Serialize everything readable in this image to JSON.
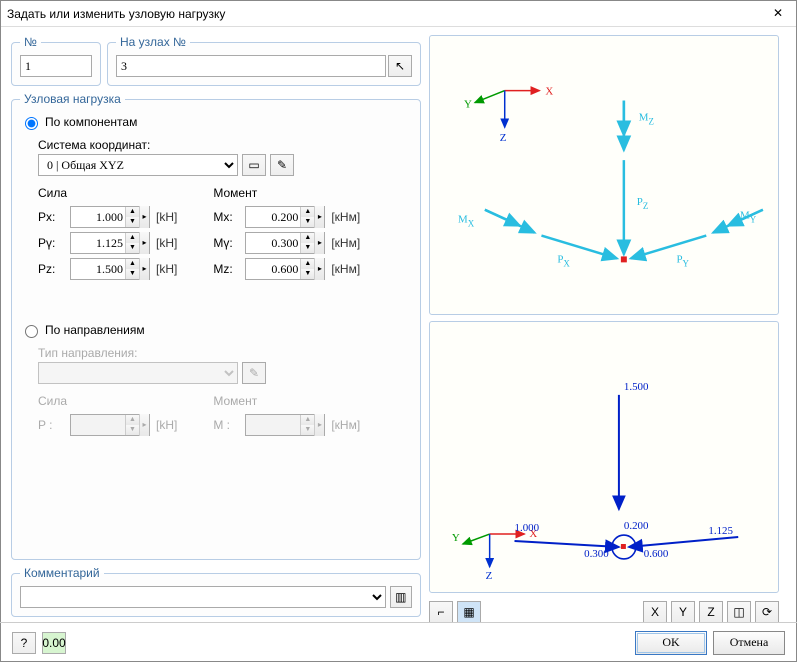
{
  "title": "Задать или изменить узловую нагрузку",
  "top": {
    "num_legend": "№",
    "num_value": "1",
    "nodes_legend": "На узлах №",
    "nodes_value": "3"
  },
  "load": {
    "legend": "Узловая нагрузка",
    "radio_components": "По компонентам",
    "coord_label": "Система координат:",
    "coord_value": "0 | Общая XYZ",
    "force_head": "Сила",
    "moment_head": "Момент",
    "px_lbl": "Pх:",
    "px_val": "1.000",
    "px_unit": "[kH]",
    "py_lbl": "Pү:",
    "py_val": "1.125",
    "py_unit": "[kH]",
    "pz_lbl": "Pz:",
    "pz_val": "1.500",
    "pz_unit": "[kH]",
    "mx_lbl": "Mх:",
    "mx_val": "0.200",
    "mx_unit": "[кНм]",
    "my_lbl": "Mү:",
    "my_val": "0.300",
    "my_unit": "[кНм]",
    "mz_lbl": "Mz:",
    "mz_val": "0.600",
    "mz_unit": "[кНм]",
    "radio_dirs": "По направлениям",
    "dir_type_label": "Тип направления:",
    "d_force_head": "Сила",
    "d_moment_head": "Момент",
    "dp_lbl": "P :",
    "dp_unit": "[kH]",
    "dm_lbl": "M :",
    "dm_unit": "[кНм]"
  },
  "comment_legend": "Комментарий",
  "preview1": {
    "axis_x": "X",
    "axis_y": "Y",
    "axis_z": "Z",
    "mz": "M",
    "mz_sub": "Z",
    "pz": "P",
    "pz_sub": "Z",
    "mx": "M",
    "mx_sub": "X",
    "my": "M",
    "my_sub": "Y",
    "px": "P",
    "px_sub": "X",
    "py": "P",
    "py_sub": "Y"
  },
  "preview2": {
    "axis_x": "X",
    "axis_y": "Y",
    "axis_z": "Z",
    "v1": "1.500",
    "v2": "1.000",
    "v3": "0.200",
    "v4": "1.125",
    "v5": "0.300",
    "v6": "0.600"
  },
  "buttons": {
    "ok": "OK",
    "cancel": "Отмена"
  }
}
